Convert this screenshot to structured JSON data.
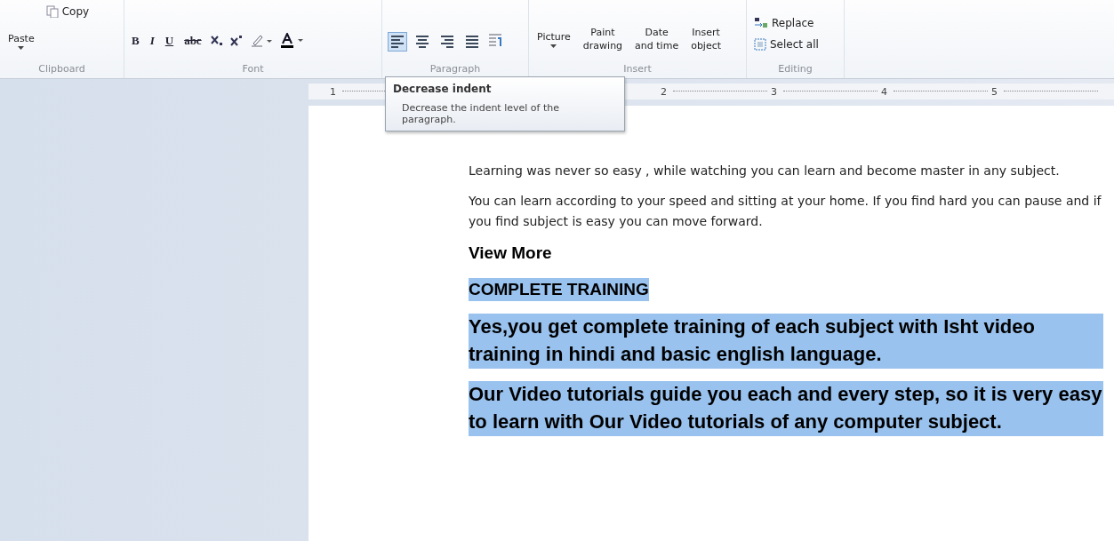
{
  "ribbon": {
    "groups": [
      {
        "kind": "clipboard",
        "label": "Clipboard",
        "paste": "Paste",
        "copy": "Copy"
      },
      {
        "kind": "font",
        "label": "Font",
        "buttons": [
          "B",
          "I",
          "U",
          "abc"
        ]
      },
      {
        "kind": "paragraph",
        "label": "Paragraph",
        "align": [
          {
            "selected": true
          },
          {
            "selected": false
          },
          {
            "selected": false
          },
          {
            "selected": false
          }
        ]
      },
      {
        "kind": "insert",
        "label": "Insert",
        "items": [
          "Picture",
          "Paint drawing",
          "Date and time",
          "Insert object"
        ]
      },
      {
        "kind": "editing",
        "label": "Editing",
        "items": [
          "Replace",
          "Select all"
        ]
      }
    ]
  },
  "ruler": {
    "labels": [
      "1",
      "2",
      "3",
      "4",
      "5"
    ]
  },
  "tooltip": {
    "title": "Decrease indent",
    "body": "Decrease the indent level of the paragraph."
  },
  "document": {
    "paragraphs": [
      {
        "kind": "normal",
        "text": "Learning was never so easy , while watching you can learn and become master in any subject.",
        "selected": false
      },
      {
        "kind": "normal",
        "text": "You can learn according to your speed and sitting at your home. If you find hard you can pause and if you find subject is easy you can move forward.",
        "selected": false
      },
      {
        "kind": "heading",
        "text": "View More",
        "selected": false
      },
      {
        "kind": "heading",
        "text": "COMPLETE TRAINING",
        "selected": true
      },
      {
        "kind": "large",
        "text": "Yes,you get complete training of each subject with Isht video training in hindi and basic english language.",
        "selected": true
      },
      {
        "kind": "large",
        "text": "Our Video tutorials guide you each and every step, so it is very easy to learn with Our Video tutorials of any computer subject.",
        "selected": true
      }
    ]
  }
}
